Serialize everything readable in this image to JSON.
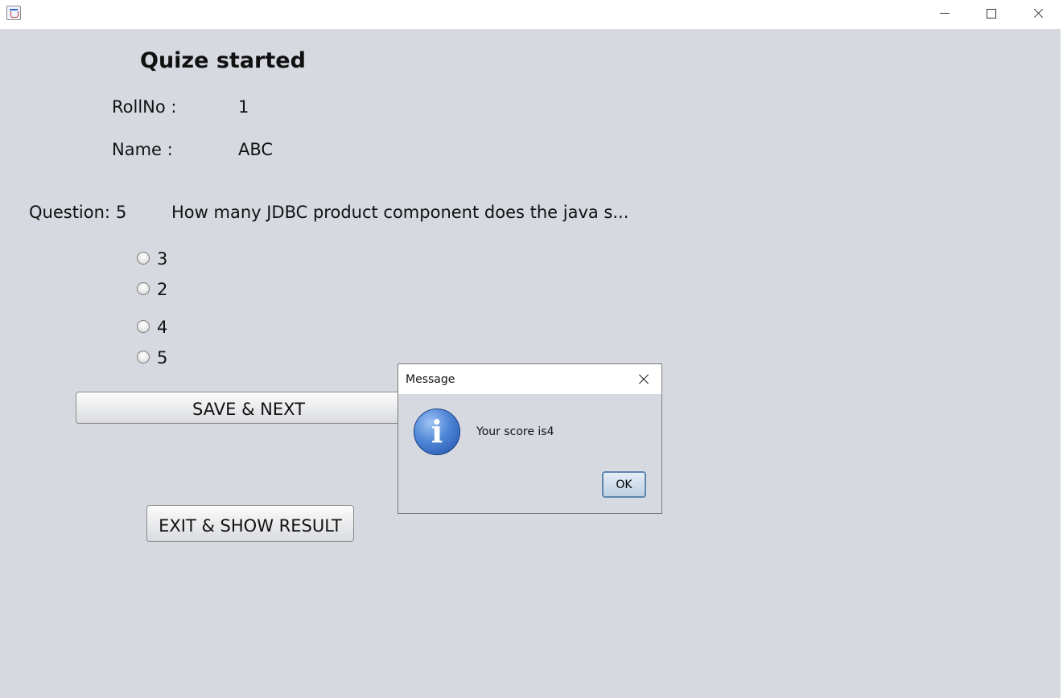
{
  "window": {
    "app_icon": "java-cup-icon"
  },
  "header": {
    "title": "Quize started"
  },
  "student": {
    "rollno_label": "RollNo :",
    "rollno_value": "1",
    "name_label": "Name :",
    "name_value": "ABC"
  },
  "question": {
    "label": "Question:",
    "number": "5",
    "text": "How many JDBC product component does the java s...",
    "options": [
      "3",
      "2",
      "4",
      "5"
    ]
  },
  "buttons": {
    "save_next": "SAVE & NEXT",
    "exit_result": "EXIT & SHOW RESULT"
  },
  "dialog": {
    "title": "Message",
    "icon": "info-icon",
    "message": "Your score is4",
    "ok_label": "OK"
  }
}
